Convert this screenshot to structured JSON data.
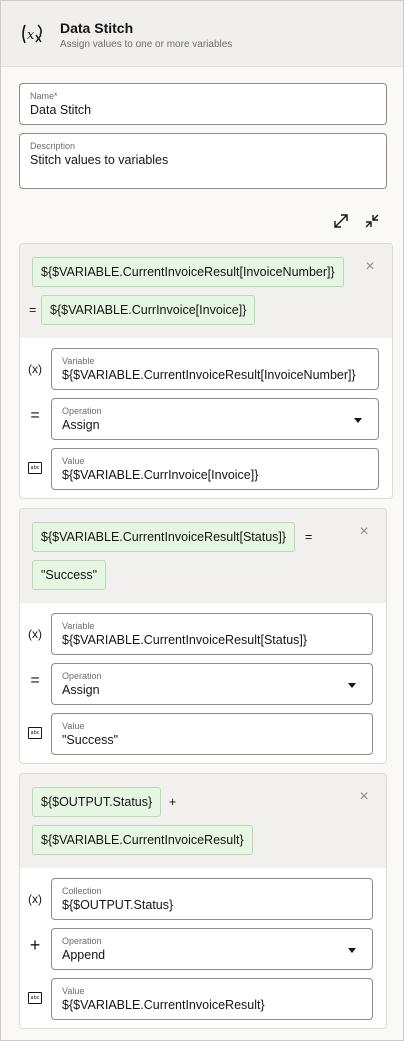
{
  "header": {
    "title": "Data Stitch",
    "subtitle": "Assign values to one or more variables",
    "icon": "x-variable-icon"
  },
  "form": {
    "name_label": "Name*",
    "name_value": "Data Stitch",
    "description_label": "Description",
    "description_value": "Stitch values to variables"
  },
  "toolbar": {
    "expand_icon": "expand-icon",
    "collapse_icon": "collapse-icon"
  },
  "cards": [
    {
      "chip_left": "${$VARIABLE.CurrentInvoiceResult[InvoiceNumber]}",
      "operator": "=",
      "chip_right": "${$VARIABLE.CurrInvoice[Invoice]}",
      "var_icon": "(x)",
      "var_label": "Variable",
      "var_value": "${$VARIABLE.CurrentInvoiceResult[InvoiceNumber]}",
      "op_icon": "=",
      "op_label": "Operation",
      "op_value": "Assign",
      "value_label": "Value",
      "value_value": "${$VARIABLE.CurrInvoice[Invoice]}"
    },
    {
      "chip_left": "${$VARIABLE.CurrentInvoiceResult[Status]}",
      "operator": "=",
      "chip_right": "\"Success\"",
      "var_icon": "(x)",
      "var_label": "Variable",
      "var_value": "${$VARIABLE.CurrentInvoiceResult[Status]}",
      "op_icon": "=",
      "op_label": "Operation",
      "op_value": "Assign",
      "value_label": "Value",
      "value_value": "\"Success\""
    },
    {
      "chip_left": "${$OUTPUT.Status}",
      "operator": "+",
      "chip_right": "${$VARIABLE.CurrentInvoiceResult}",
      "var_icon": "(x)",
      "var_label": "Collection",
      "var_value": "${$OUTPUT.Status}",
      "op_icon": "+",
      "op_label": "Operation",
      "op_value": "Append",
      "value_label": "Value",
      "value_value": "${$VARIABLE.CurrentInvoiceResult}"
    }
  ],
  "abc_text": "abc",
  "close_glyph": "×"
}
